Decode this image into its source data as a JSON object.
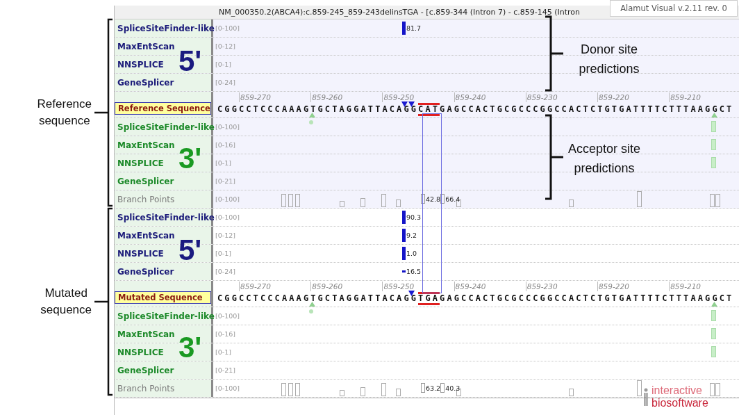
{
  "title": "NM_000350.2(ABCA4):c.859-245_859-243delinsTGA - [c.859-344 (Intron 7) - c.859-145 (Intron",
  "version_badge": "Alamut Visual v.2.11 rev. 0",
  "blocks": [
    {
      "kind": "reference",
      "donor_mark": "5'",
      "acceptor_mark": "3'",
      "annotation": [
        "Reference",
        "sequence"
      ],
      "rows": [
        {
          "kind": "donor",
          "name": "SpliceSiteFinder-like",
          "range": "[0-100]",
          "scores": [
            {
              "value": "81.7",
              "kind": "bar"
            }
          ]
        },
        {
          "kind": "donor",
          "name": "MaxEntScan",
          "range": "[0-12]"
        },
        {
          "kind": "donor",
          "name": "NNSPLICE",
          "range": "[0-1]"
        },
        {
          "kind": "donor",
          "name": "GeneSplicer",
          "range": "[0-24]"
        },
        {
          "kind": "sequence",
          "name": "Reference Sequence",
          "ruler": [
            "859-270",
            "859-260",
            "859-250",
            "859-240",
            "859-230",
            "859-220",
            "859-210"
          ],
          "parts": [
            {
              "text": "CGGCCTCCCAAAGTGCTAGGATTACAGG",
              "marked": false
            },
            {
              "text": "CAT",
              "marked": true
            },
            {
              "text": "GAGCCACTGCGCCCGGCCACTCTGTGATTTTCTTTAAGGCT",
              "marked": false
            }
          ]
        },
        {
          "kind": "acceptor",
          "name": "SpliceSiteFinder-like",
          "range": "[0-100]"
        },
        {
          "kind": "acceptor",
          "name": "MaxEntScan",
          "range": "[0-16]"
        },
        {
          "kind": "acceptor",
          "name": "NNSPLICE",
          "range": "[0-1]"
        },
        {
          "kind": "acceptor",
          "name": "GeneSplicer",
          "range": "[0-21]"
        },
        {
          "kind": "branch",
          "name": "Branch Points",
          "range": "[0-100]",
          "scores": [
            {
              "value": "42.8"
            },
            {
              "value": "66.4"
            }
          ]
        }
      ]
    },
    {
      "kind": "mutated",
      "donor_mark": "5'",
      "acceptor_mark": "3'",
      "annotation": [
        "Mutated",
        "sequence"
      ],
      "rows": [
        {
          "kind": "donor",
          "name": "SpliceSiteFinder-like",
          "range": "[0-100]",
          "scores": [
            {
              "value": "90.3",
              "kind": "bar"
            }
          ]
        },
        {
          "kind": "donor",
          "name": "MaxEntScan",
          "range": "[0-12]",
          "scores": [
            {
              "value": "9.2",
              "kind": "bar"
            }
          ]
        },
        {
          "kind": "donor",
          "name": "NNSPLICE",
          "range": "[0-1]",
          "scores": [
            {
              "value": "1.0",
              "kind": "bar"
            }
          ]
        },
        {
          "kind": "donor",
          "name": "GeneSplicer",
          "range": "[0-24]",
          "scores": [
            {
              "value": "16.5",
              "kind": "tick"
            }
          ]
        },
        {
          "kind": "sequence",
          "name": "Mutated Sequence",
          "ruler": [
            "859-270",
            "859-260",
            "859-250",
            "859-240",
            "859-230",
            "859-220",
            "859-210"
          ],
          "parts": [
            {
              "text": "CGGCCTCCCAAAGTGCTAGGATTACAGG",
              "marked": false
            },
            {
              "text": "TGA",
              "marked": true
            },
            {
              "text": "GAGCCACTGCGCCCGGCCACTCTGTGATTTTCTTTAAGGCT",
              "marked": false
            }
          ]
        },
        {
          "kind": "acceptor",
          "name": "SpliceSiteFinder-like",
          "range": "[0-100]"
        },
        {
          "kind": "acceptor",
          "name": "MaxEntScan",
          "range": "[0-16]"
        },
        {
          "kind": "acceptor",
          "name": "NNSPLICE",
          "range": "[0-1]"
        },
        {
          "kind": "acceptor",
          "name": "GeneSplicer",
          "range": "[0-21]"
        },
        {
          "kind": "branch",
          "name": "Branch Points",
          "range": "[0-100]",
          "scores": [
            {
              "value": "63.2"
            },
            {
              "value": "40.3"
            }
          ]
        }
      ]
    }
  ],
  "callouts": [
    {
      "kind": "donor",
      "lines": [
        "Donor site",
        "predictions"
      ]
    },
    {
      "kind": "acceptor",
      "lines": [
        "Acceptor site",
        "predictions"
      ]
    }
  ],
  "logo": {
    "line_1": "interactive",
    "line_2": "biosoftware"
  }
}
